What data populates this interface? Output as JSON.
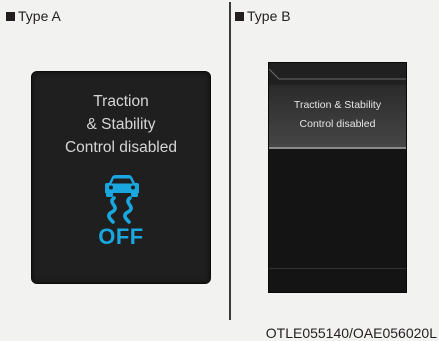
{
  "type_a": {
    "label": "Type A",
    "message_lines": [
      "Traction",
      "& Stability",
      "Control disabled"
    ],
    "status_text": "OFF",
    "icon": "traction-control-off-icon",
    "icon_color": "#1aa6de"
  },
  "type_b": {
    "label": "Type B",
    "message_lines": [
      "Traction & Stability",
      "Control disabled"
    ]
  },
  "figure_code": "OTLE055140/OAE056020L"
}
